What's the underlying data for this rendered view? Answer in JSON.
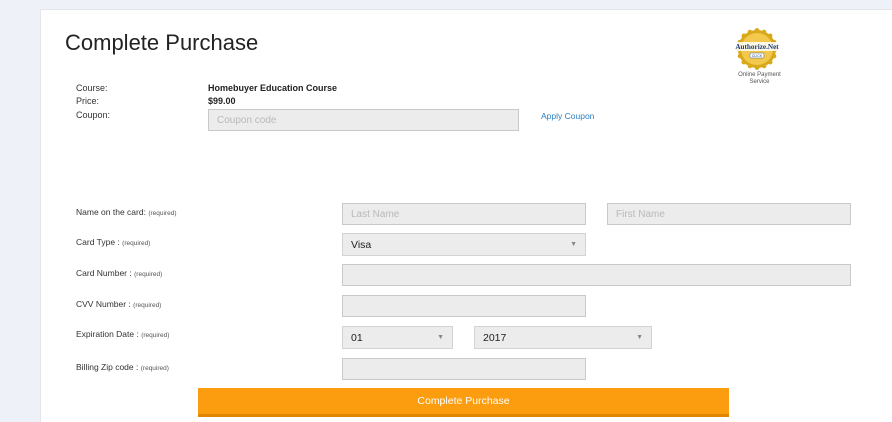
{
  "header": {
    "title": "Complete Purchase"
  },
  "seal": {
    "logo_text": "Authorize.Net",
    "badge_text": "CLICK",
    "caption_line1": "Online Payment",
    "caption_line2": "Service",
    "colors": {
      "gold": "#d9a91c",
      "navy": "#1d3f7a"
    }
  },
  "summary": {
    "course_label": "Course:",
    "course_value": "Homebuyer Education Course",
    "price_label": "Price:",
    "price_value": "$99.00",
    "coupon_label": "Coupon:",
    "coupon_placeholder": "Coupon code",
    "apply_coupon": "Apply Coupon"
  },
  "form": {
    "required": "(required)",
    "name_label": "Name on the card:",
    "last_name_placeholder": "Last Name",
    "first_name_placeholder": "First Name",
    "card_type_label": "Card Type :",
    "card_type_value": "Visa",
    "card_number_label": "Card Number :",
    "cvv_label": "CVV Number :",
    "expiration_label": "Expiration Date :",
    "exp_month_value": "01",
    "exp_year_value": "2017",
    "zip_label": "Billing Zip code :"
  },
  "submit": {
    "label": "Complete Purchase",
    "color": "#fb9d0e"
  }
}
